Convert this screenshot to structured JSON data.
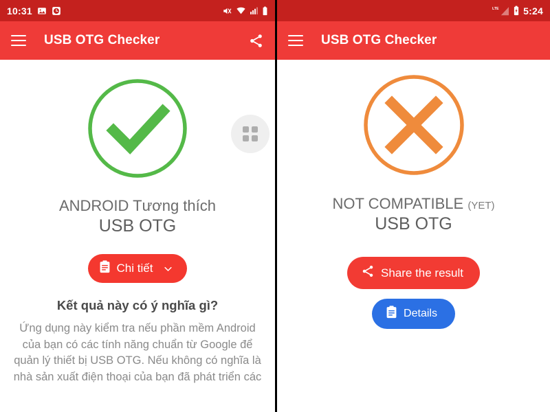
{
  "left_phone": {
    "statusbar": {
      "time": "10:31",
      "icons": [
        "image-icon",
        "alarm-icon",
        "mute-icon",
        "wifi-icon",
        "signal-icon",
        "battery-icon"
      ]
    },
    "appbar": {
      "menu_icon": "hamburger-icon",
      "title": "USB OTG Checker",
      "action_icon": "share-icon"
    },
    "status": {
      "icon": "check-circle-icon",
      "icon_color": "#54B948",
      "title": "ANDROID Tương thích",
      "subtitle": "USB OTG"
    },
    "details_button": {
      "label": "Chi tiết",
      "icon": "clipboard-icon",
      "chevron": "chevron-down-icon",
      "color": "#F4382F"
    },
    "fab": {
      "icon": "apps-grid-icon"
    },
    "explanation": {
      "heading": "Kết quả này có ý nghĩa gì?",
      "body": "Ứng dụng này kiểm tra nếu phần mềm Android của bạn có các tính năng chuẩn từ Google để quản lý thiết bị USB OTG. Nếu không có nghĩa là nhà sản xuất điện thoại của bạn đã phát triển các"
    }
  },
  "right_phone": {
    "statusbar": {
      "time": "5:24",
      "network": "LTE",
      "icons": [
        "lte-icon",
        "signal-icon",
        "battery-charging-icon"
      ]
    },
    "appbar": {
      "menu_icon": "hamburger-icon",
      "title": "USB OTG Checker"
    },
    "status": {
      "icon": "x-circle-icon",
      "icon_color": "#EF8B3C",
      "title": "NOT COMPATIBLE",
      "title_suffix": "(YET)",
      "subtitle": "USB OTG"
    },
    "share_button": {
      "label": "Share the result",
      "icon": "share-icon",
      "color": "#F23B33"
    },
    "details_button": {
      "label": "Details",
      "icon": "clipboard-icon",
      "color": "#2B70E4"
    }
  },
  "theme": {
    "statusbar_color": "#C4211E",
    "appbar_color": "#EF3B38",
    "success_color": "#54B948",
    "error_color": "#EF8B3C"
  }
}
